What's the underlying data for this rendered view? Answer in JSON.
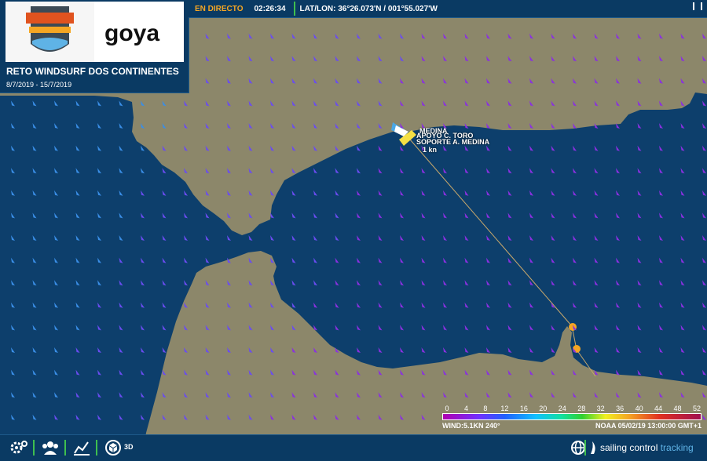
{
  "event": {
    "title": "RETO WINDSURF DOS CONTINENTES",
    "dates": "8/7/2019 - 15/7/2019",
    "logo_badge": "RETO WINDSURF 2 CONTINENTES",
    "logo_brand": "goya"
  },
  "topbar": {
    "live_label": "EN DIRECTO",
    "time": "02:26:34",
    "latlon": "LAT/LON: 36°26.073'N / 001°55.027'W"
  },
  "map": {
    "land_color": "#8c876a",
    "sea_color": "#0d3f6c",
    "track_color": "#c9a86b",
    "marker_color": "#f5a623",
    "boat_labels": {
      "label_1": "MEDINA",
      "label_2": "APOYO C. TORO",
      "label_3": "SOPORTE A. MEDINA",
      "label_4": "1 kn"
    }
  },
  "legend": {
    "ticks": [
      "0",
      "4",
      "8",
      "12",
      "16",
      "20",
      "24",
      "28",
      "32",
      "36",
      "40",
      "44",
      "48",
      "52"
    ],
    "wind_text": "WIND:5.1KN 240°",
    "source_text": "NOAA 05/02/19 13:00:00 GMT+1"
  },
  "bottombar": {
    "label_3d": "3D",
    "brand_a": "sailing control",
    "brand_b": " tracking",
    "icons": [
      "settings-icon",
      "group-icon",
      "chart-icon",
      "cube-icon",
      "globe-icon",
      "sail-logo-icon"
    ]
  }
}
